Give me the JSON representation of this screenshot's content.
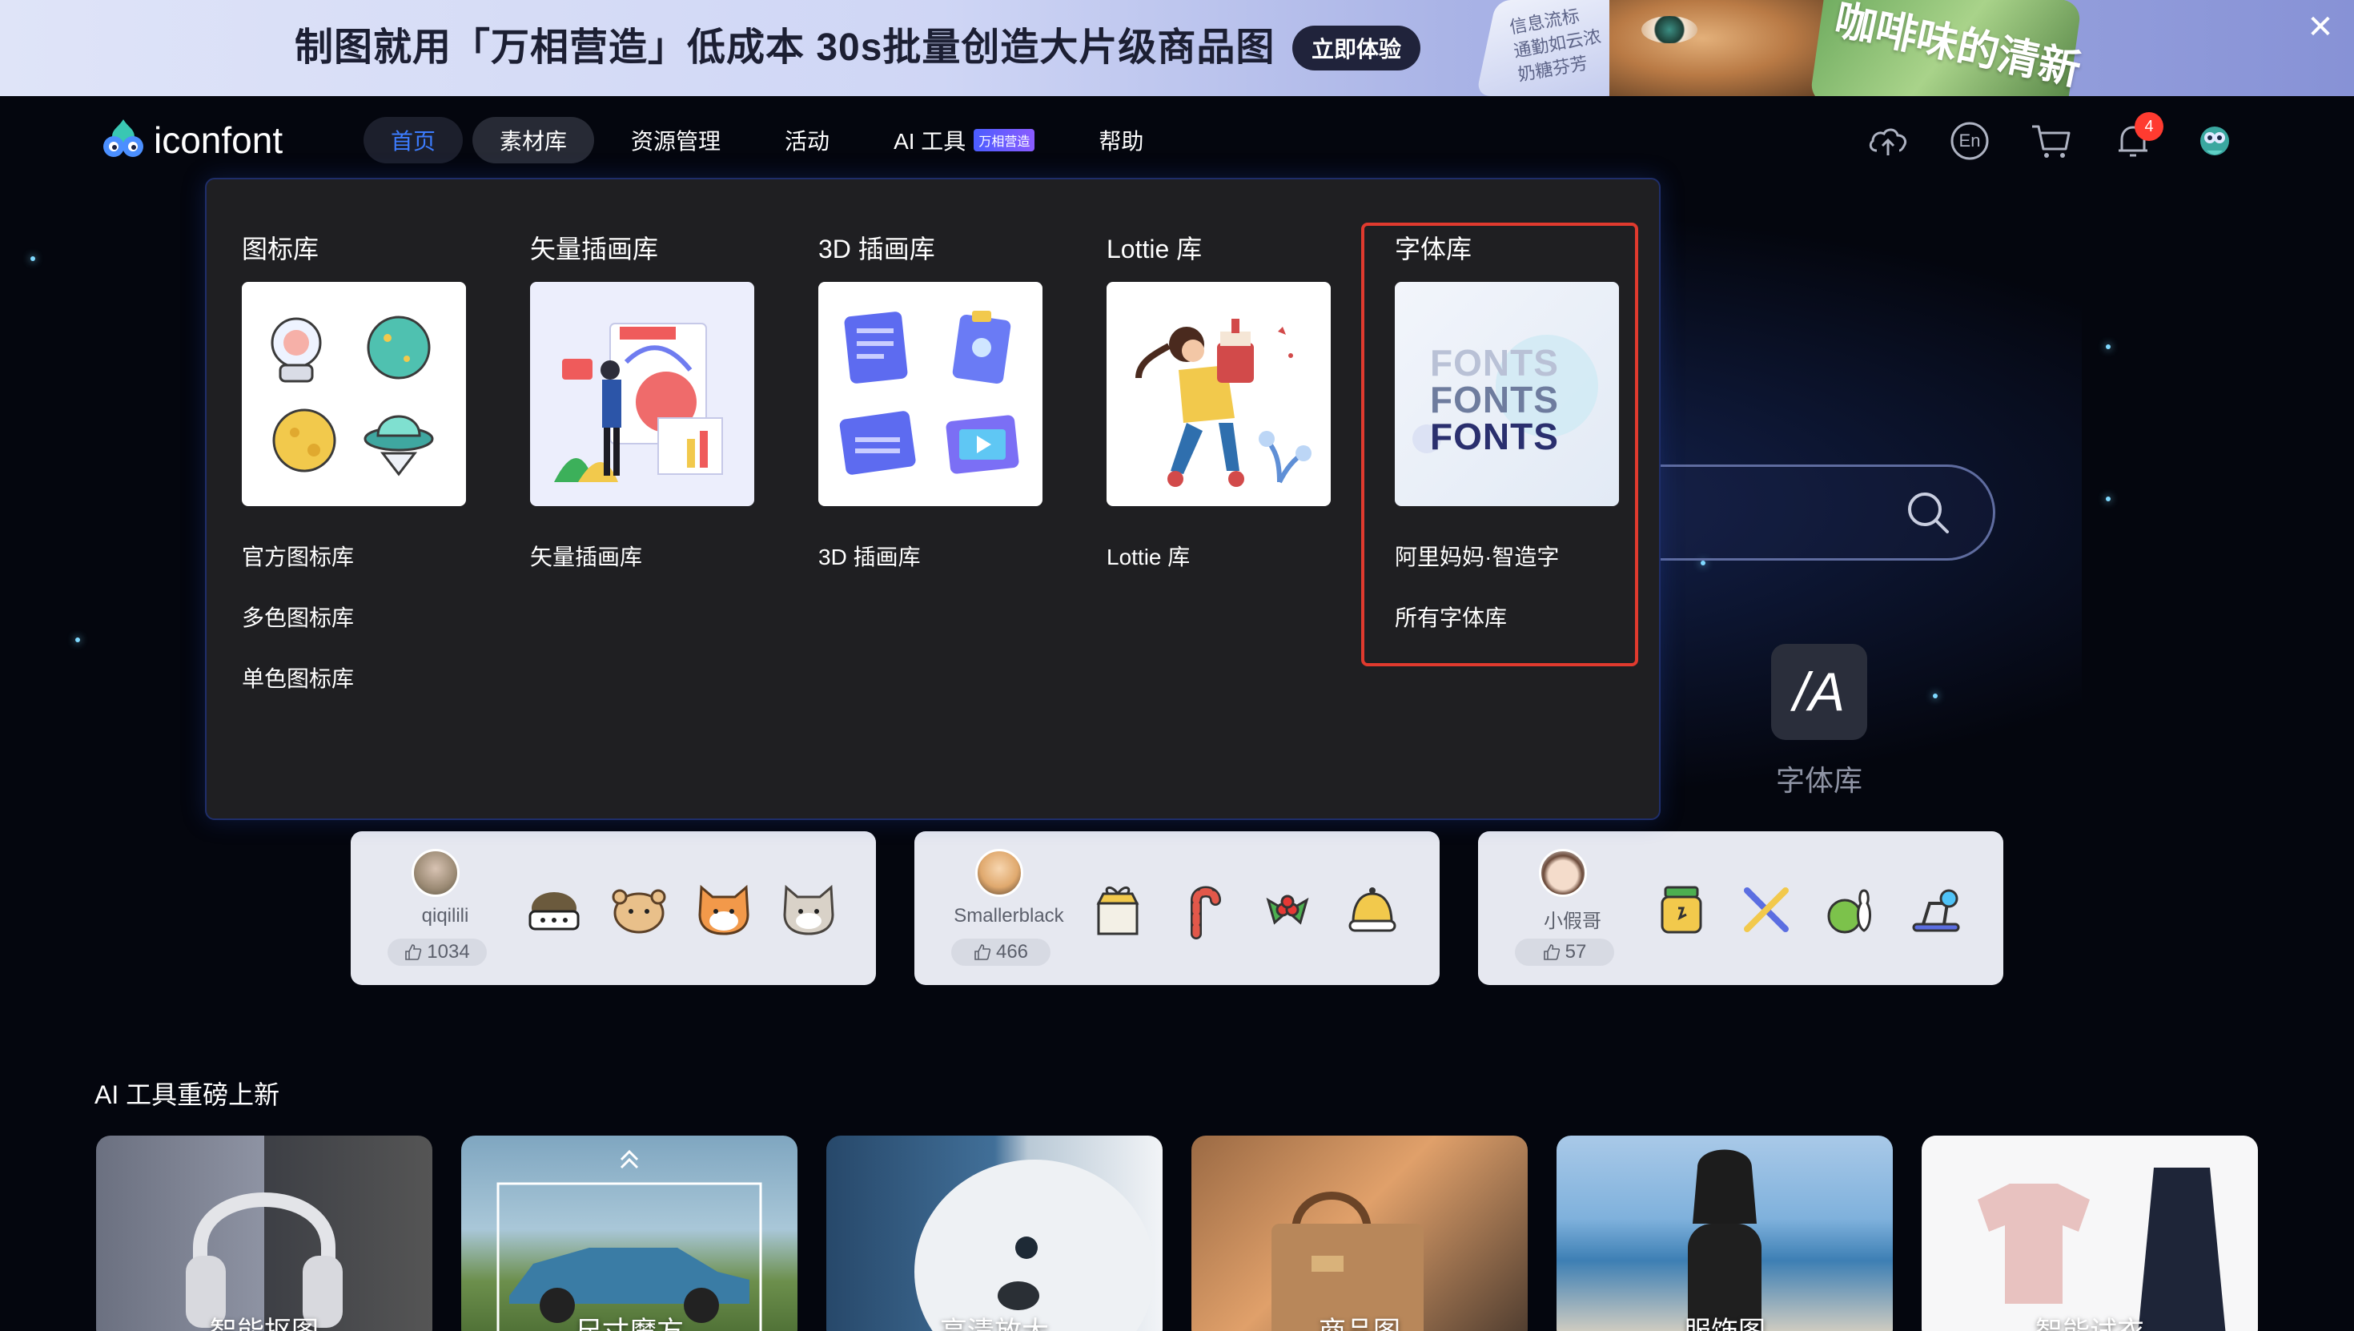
{
  "banner": {
    "text": "制图就用「万相营造」低成本 30s批量创造大片级商品图",
    "button": "立即体验",
    "card_text_1": "信息流标",
    "card_text_2": "通勤如云浓",
    "card_text_3": "奶糖芬芳",
    "overlay_text": "咖啡味的清新"
  },
  "header": {
    "logo_text": "iconfont",
    "nav": [
      {
        "label": "首页"
      },
      {
        "label": "素材库"
      },
      {
        "label": "资源管理"
      },
      {
        "label": "活动"
      },
      {
        "label": "AI 工具",
        "badge": "万相营造"
      },
      {
        "label": "帮助"
      }
    ],
    "lang_label": "En",
    "notification_count": "4"
  },
  "dropdown": {
    "columns": [
      {
        "heading": "图标库",
        "links": [
          "官方图标库",
          "多色图标库",
          "单色图标库"
        ]
      },
      {
        "heading": "矢量插画库",
        "links": [
          "矢量插画库"
        ]
      },
      {
        "heading": "3D 插画库",
        "links": [
          "3D 插画库"
        ]
      },
      {
        "heading": "Lottie 库",
        "links": [
          "Lottie 库"
        ]
      },
      {
        "heading": "字体库",
        "links": [
          "阿里妈妈·智造字",
          "所有字体库"
        ],
        "thumb_text": [
          "FONTS",
          "FONTS",
          "FONTS"
        ]
      }
    ]
  },
  "hero": {
    "font_tile_glyph": "/A",
    "font_tile_label": "字体库"
  },
  "creators": [
    {
      "name": "qiqilili",
      "likes": "1034"
    },
    {
      "name": "Smallerblack",
      "likes": "466"
    },
    {
      "name": "小假哥",
      "likes": "57"
    }
  ],
  "ai_section": {
    "title": "AI 工具重磅上新",
    "cards": [
      "智能抠图",
      "尺寸魔方",
      "高清放大",
      "商品图",
      "服饰图",
      "智能试衣"
    ]
  },
  "colors": {
    "brand_blue": "#3c7cff",
    "highlight_red": "#e03a2e",
    "badge_red": "#ff3b30"
  }
}
